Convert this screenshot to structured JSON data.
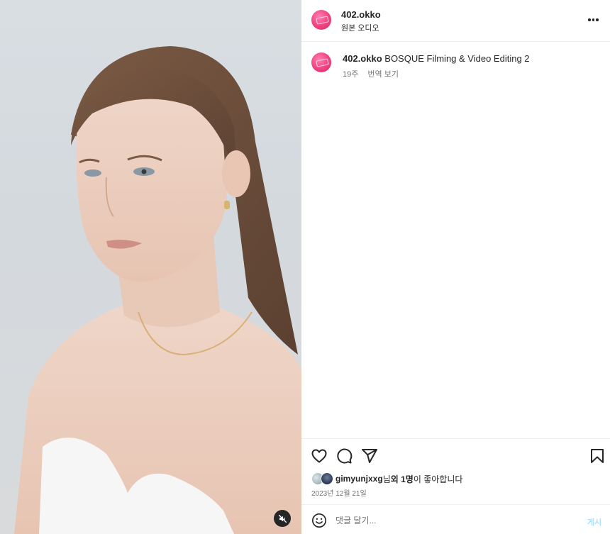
{
  "post": {
    "username": "402.okko",
    "audio_label": "원본 오디오"
  },
  "caption": {
    "username": "402.okko",
    "text": " BOSQUE Filming & Video Editing 2",
    "age": "19주",
    "translate": "번역 보기"
  },
  "actions": {
    "icons": [
      "heart-icon",
      "comment-icon",
      "share-icon",
      "bookmark-icon"
    ]
  },
  "likes": {
    "liker": "gimyunjxxg",
    "suffix_a": "님 ",
    "others": "외 1명",
    "suffix_b": "이 좋아합니다"
  },
  "date": "2023년 12월 21일",
  "comment": {
    "placeholder": "댓글 달기...",
    "post_label": "게시"
  },
  "colors": {
    "accent": "#0095f6",
    "avatar": "#f0417f"
  }
}
